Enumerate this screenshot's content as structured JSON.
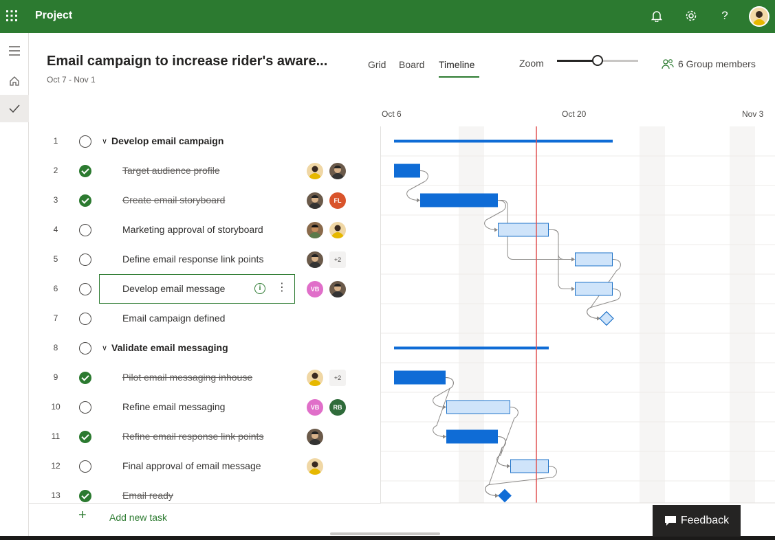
{
  "app": {
    "title": "Project"
  },
  "header": {
    "project_title": "Email campaign to increase rider's aware...",
    "dates": "Oct 7 - Nov 1",
    "tabs": [
      {
        "label": "Grid",
        "active": false
      },
      {
        "label": "Board",
        "active": false
      },
      {
        "label": "Timeline",
        "active": true
      }
    ],
    "zoom_label": "Zoom",
    "zoom_level": 0.5,
    "members_label": "6 Group members"
  },
  "timeline_dates": [
    "Oct 6",
    "Oct 20",
    "Nov 3"
  ],
  "tasks": [
    {
      "num": "1",
      "name": "Develop email campaign",
      "done": false,
      "summary": true,
      "assignees": []
    },
    {
      "num": "2",
      "name": "Target audience profile",
      "done": true,
      "summary": false,
      "assignees": [
        {
          "type": "photo-a"
        },
        {
          "type": "photo-b"
        }
      ]
    },
    {
      "num": "3",
      "name": "Create email storyboard",
      "done": true,
      "summary": false,
      "assignees": [
        {
          "type": "photo-b"
        },
        {
          "type": "initials",
          "text": "FL",
          "color": "#d9542b"
        }
      ]
    },
    {
      "num": "4",
      "name": "Marketing approval of storyboard",
      "done": false,
      "summary": false,
      "assignees": [
        {
          "type": "photo-c"
        },
        {
          "type": "photo-a"
        }
      ]
    },
    {
      "num": "5",
      "name": "Define email response link points",
      "done": false,
      "summary": false,
      "assignees": [
        {
          "type": "photo-b"
        },
        {
          "type": "plus",
          "text": "+2"
        }
      ]
    },
    {
      "num": "6",
      "name": "Develop email message",
      "done": false,
      "summary": false,
      "selected": true,
      "assignees": [
        {
          "type": "initials",
          "text": "VB",
          "color": "#e06fc9"
        },
        {
          "type": "photo-b"
        }
      ]
    },
    {
      "num": "7",
      "name": "Email campaign defined",
      "done": false,
      "summary": false,
      "assignees": []
    },
    {
      "num": "8",
      "name": "Validate email messaging",
      "done": false,
      "summary": true,
      "assignees": []
    },
    {
      "num": "9",
      "name": "Pilot email messaging inhouse",
      "done": true,
      "summary": false,
      "assignees": [
        {
          "type": "photo-a"
        },
        {
          "type": "plus",
          "text": "+2"
        }
      ]
    },
    {
      "num": "10",
      "name": "Refine email messaging",
      "done": false,
      "summary": false,
      "assignees": [
        {
          "type": "initials",
          "text": "VB",
          "color": "#e06fc9"
        },
        {
          "type": "initials",
          "text": "RB",
          "color": "#2f6b3a"
        }
      ]
    },
    {
      "num": "11",
      "name": "Refine email response link points",
      "done": true,
      "summary": false,
      "assignees": [
        {
          "type": "photo-b"
        }
      ]
    },
    {
      "num": "12",
      "name": "Final approval of email message",
      "done": false,
      "summary": false,
      "assignees": [
        {
          "type": "photo-a"
        }
      ]
    },
    {
      "num": "13",
      "name": "Email ready",
      "done": true,
      "summary": false,
      "assignees": []
    }
  ],
  "add_task_label": "Add new task",
  "feedback_label": "Feedback",
  "colors": {
    "brand": "#2c7a30",
    "bar_done": "#0f6cd6",
    "bar_todo_fill": "#cfe4fa",
    "bar_todo_border": "#1f73c9",
    "today_line": "#e05050"
  }
}
